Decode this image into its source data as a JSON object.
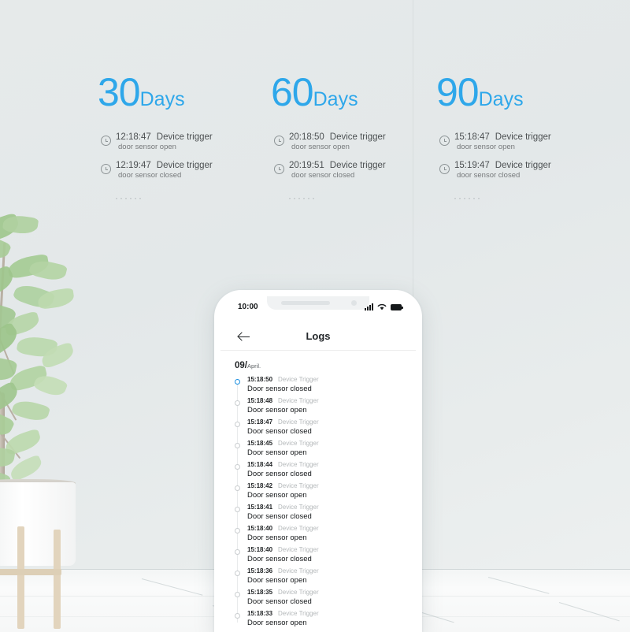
{
  "background": {
    "wall_color": "#e4e9e9",
    "floor_color": "#f7f9f9",
    "accent_blue": "#2ea7ea"
  },
  "cards": [
    {
      "number": "30",
      "unit": "Days",
      "events": [
        {
          "icon": "clock-icon",
          "time": "12:18:47",
          "label": "Device trigger",
          "detail": "door sensor open"
        },
        {
          "icon": "clock-icon",
          "time": "12:19:47",
          "label": "Device trigger",
          "detail": "door sensor closed"
        }
      ],
      "ellipsis": "······"
    },
    {
      "number": "60",
      "unit": "Days",
      "events": [
        {
          "icon": "clock-icon",
          "time": "20:18:50",
          "label": "Device trigger",
          "detail": "door sensor open"
        },
        {
          "icon": "clock-icon",
          "time": "20:19:51",
          "label": "Device trigger",
          "detail": "door sensor closed"
        }
      ],
      "ellipsis": "······"
    },
    {
      "number": "90",
      "unit": "Days",
      "events": [
        {
          "icon": "clock-icon",
          "time": "15:18:47",
          "label": "Device trigger",
          "detail": "door sensor open"
        },
        {
          "icon": "clock-icon",
          "time": "15:19:47",
          "label": "Device trigger",
          "detail": "door sensor closed"
        }
      ],
      "ellipsis": "······"
    }
  ],
  "phone": {
    "statusbar": {
      "time": "10:00",
      "icons": [
        "signal-icon",
        "wifi-icon",
        "battery-icon"
      ]
    },
    "navbar": {
      "back_icon": "back-arrow-icon",
      "title": "Logs"
    },
    "date_header": {
      "day": "09/",
      "month": "April."
    },
    "logs": [
      {
        "time": "15:18:50",
        "type": "Device Trigger",
        "message": "Door sensor closed",
        "active": true
      },
      {
        "time": "15:18:48",
        "type": "Device Trigger",
        "message": "Door sensor open",
        "active": false
      },
      {
        "time": "15:18:47",
        "type": "Device Trigger",
        "message": "Door sensor closed",
        "active": false
      },
      {
        "time": "15:18:45",
        "type": "Device Trigger",
        "message": "Door sensor open",
        "active": false
      },
      {
        "time": "15:18:44",
        "type": "Device Trigger",
        "message": "Door sensor closed",
        "active": false
      },
      {
        "time": "15:18:42",
        "type": "Device Trigger",
        "message": "Door sensor open",
        "active": false
      },
      {
        "time": "15:18:41",
        "type": "Device Trigger",
        "message": "Door sensor closed",
        "active": false
      },
      {
        "time": "15:18:40",
        "type": "Device Trigger",
        "message": "Door sensor open",
        "active": false
      },
      {
        "time": "15:18:40",
        "type": "Device Trigger",
        "message": "Door sensor closed",
        "active": false
      },
      {
        "time": "15:18:36",
        "type": "Device Trigger",
        "message": "Door sensor open",
        "active": false
      },
      {
        "time": "15:18:35",
        "type": "Device Trigger",
        "message": "Door sensor closed",
        "active": false
      },
      {
        "time": "15:18:33",
        "type": "Device Trigger",
        "message": "Door sensor open",
        "active": false
      }
    ]
  },
  "scene": {
    "plant": "potted-plant",
    "pot": "white-planter",
    "stand": "wooden-plant-stand"
  }
}
